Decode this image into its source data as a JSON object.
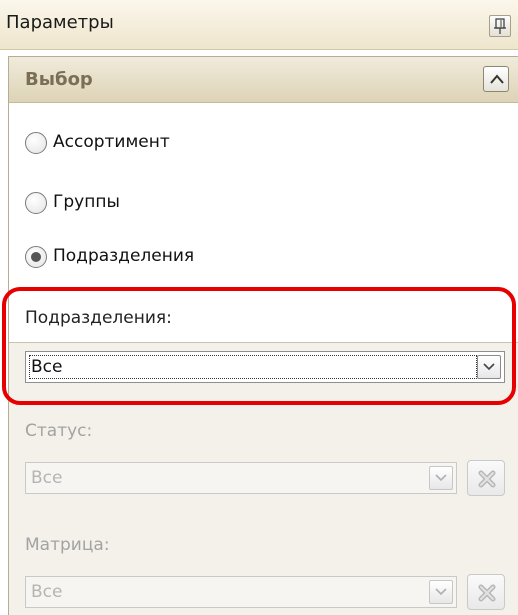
{
  "panel": {
    "title": "Параметры",
    "pin_icon": "pin-icon",
    "pin_glyph": "ꟼ"
  },
  "group": {
    "title": "Выбор",
    "collapse_icon": "chevron-up-icon"
  },
  "radios": [
    {
      "label": "Ассортимент",
      "selected": false
    },
    {
      "label": "Группы",
      "selected": false
    },
    {
      "label": "Подразделения",
      "selected": true
    }
  ],
  "fields": {
    "departments": {
      "label": "Подразделения:",
      "value": "Все",
      "enabled": true
    },
    "status": {
      "label": "Статус:",
      "value": "Все",
      "enabled": false
    },
    "matrix": {
      "label": "Матрица:",
      "value": "Все",
      "enabled": false
    }
  },
  "colors": {
    "highlight": "#e60000",
    "header_bg": "#eee5cc",
    "group_title": "#7a6f55",
    "disabled_text": "#a3a3a3"
  }
}
